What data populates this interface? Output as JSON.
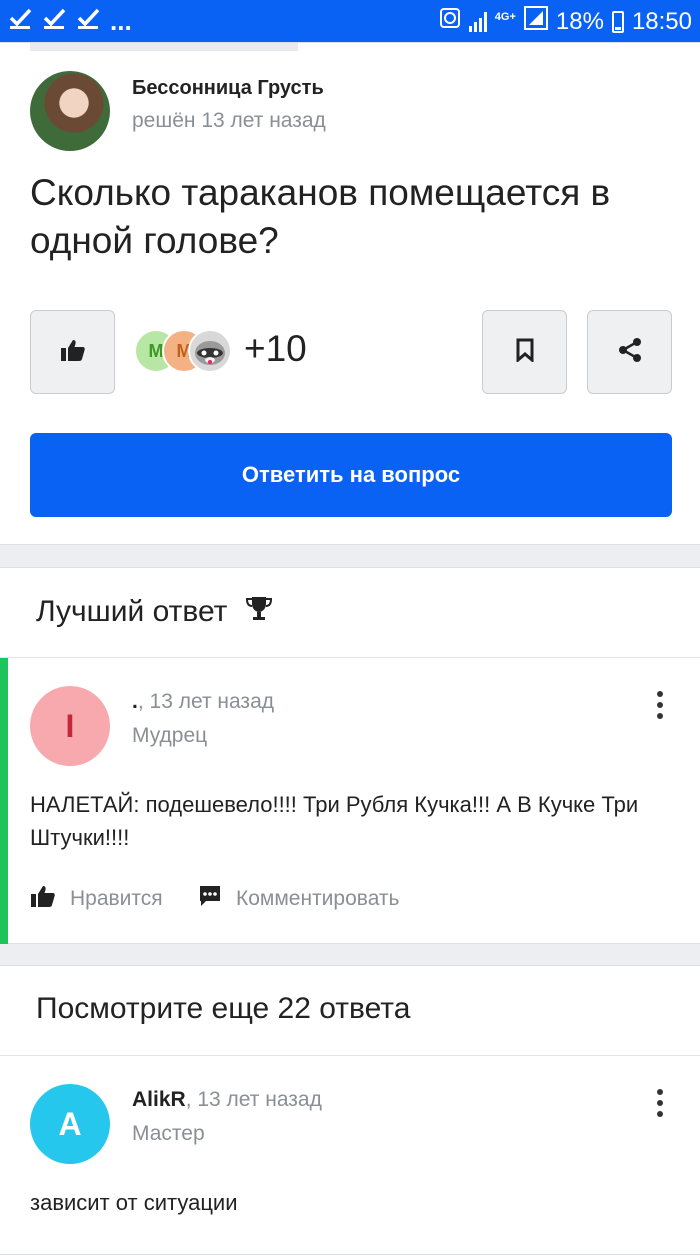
{
  "status_bar": {
    "left_icons": [
      "check-icon",
      "check-icon",
      "check-icon"
    ],
    "more": "...",
    "network": "4G+",
    "battery": "18%",
    "time": "18:50"
  },
  "question": {
    "author_name": "Бессонница Грусть",
    "meta": "решён 13 лет назад",
    "title": "Сколько тараканов помещается в одной голове?",
    "liker_initials": [
      "М",
      "М"
    ],
    "likes_count": "+10",
    "answer_button": "Ответить на вопрос"
  },
  "best_answer": {
    "section_title": "Лучший ответ",
    "avatar_letter": "I",
    "author": ".",
    "time": ", 13 лет назад",
    "rank": "Мудрец",
    "text": "НАЛЕТАЙ: подешевело!!!! Три Рубля Кучка!!! А В Кучке Три Штучки!!!!",
    "like_label": "Нравится",
    "comment_label": "Комментировать",
    "colors": {
      "accent_bar": "#1fc35b",
      "avatar_bg": "#f7a9ad",
      "avatar_fg": "#c2283a"
    }
  },
  "more_answers": {
    "section_title": "Посмотрите еще 22 ответа",
    "first": {
      "avatar_letter": "A",
      "author": "AlikR",
      "time": ", 13 лет назад",
      "rank": "Мастер",
      "text": "зависит от ситуации",
      "colors": {
        "avatar_bg": "#25c8ec",
        "avatar_fg": "#ffffff"
      }
    }
  },
  "colors": {
    "brand": "#0a62f5"
  }
}
